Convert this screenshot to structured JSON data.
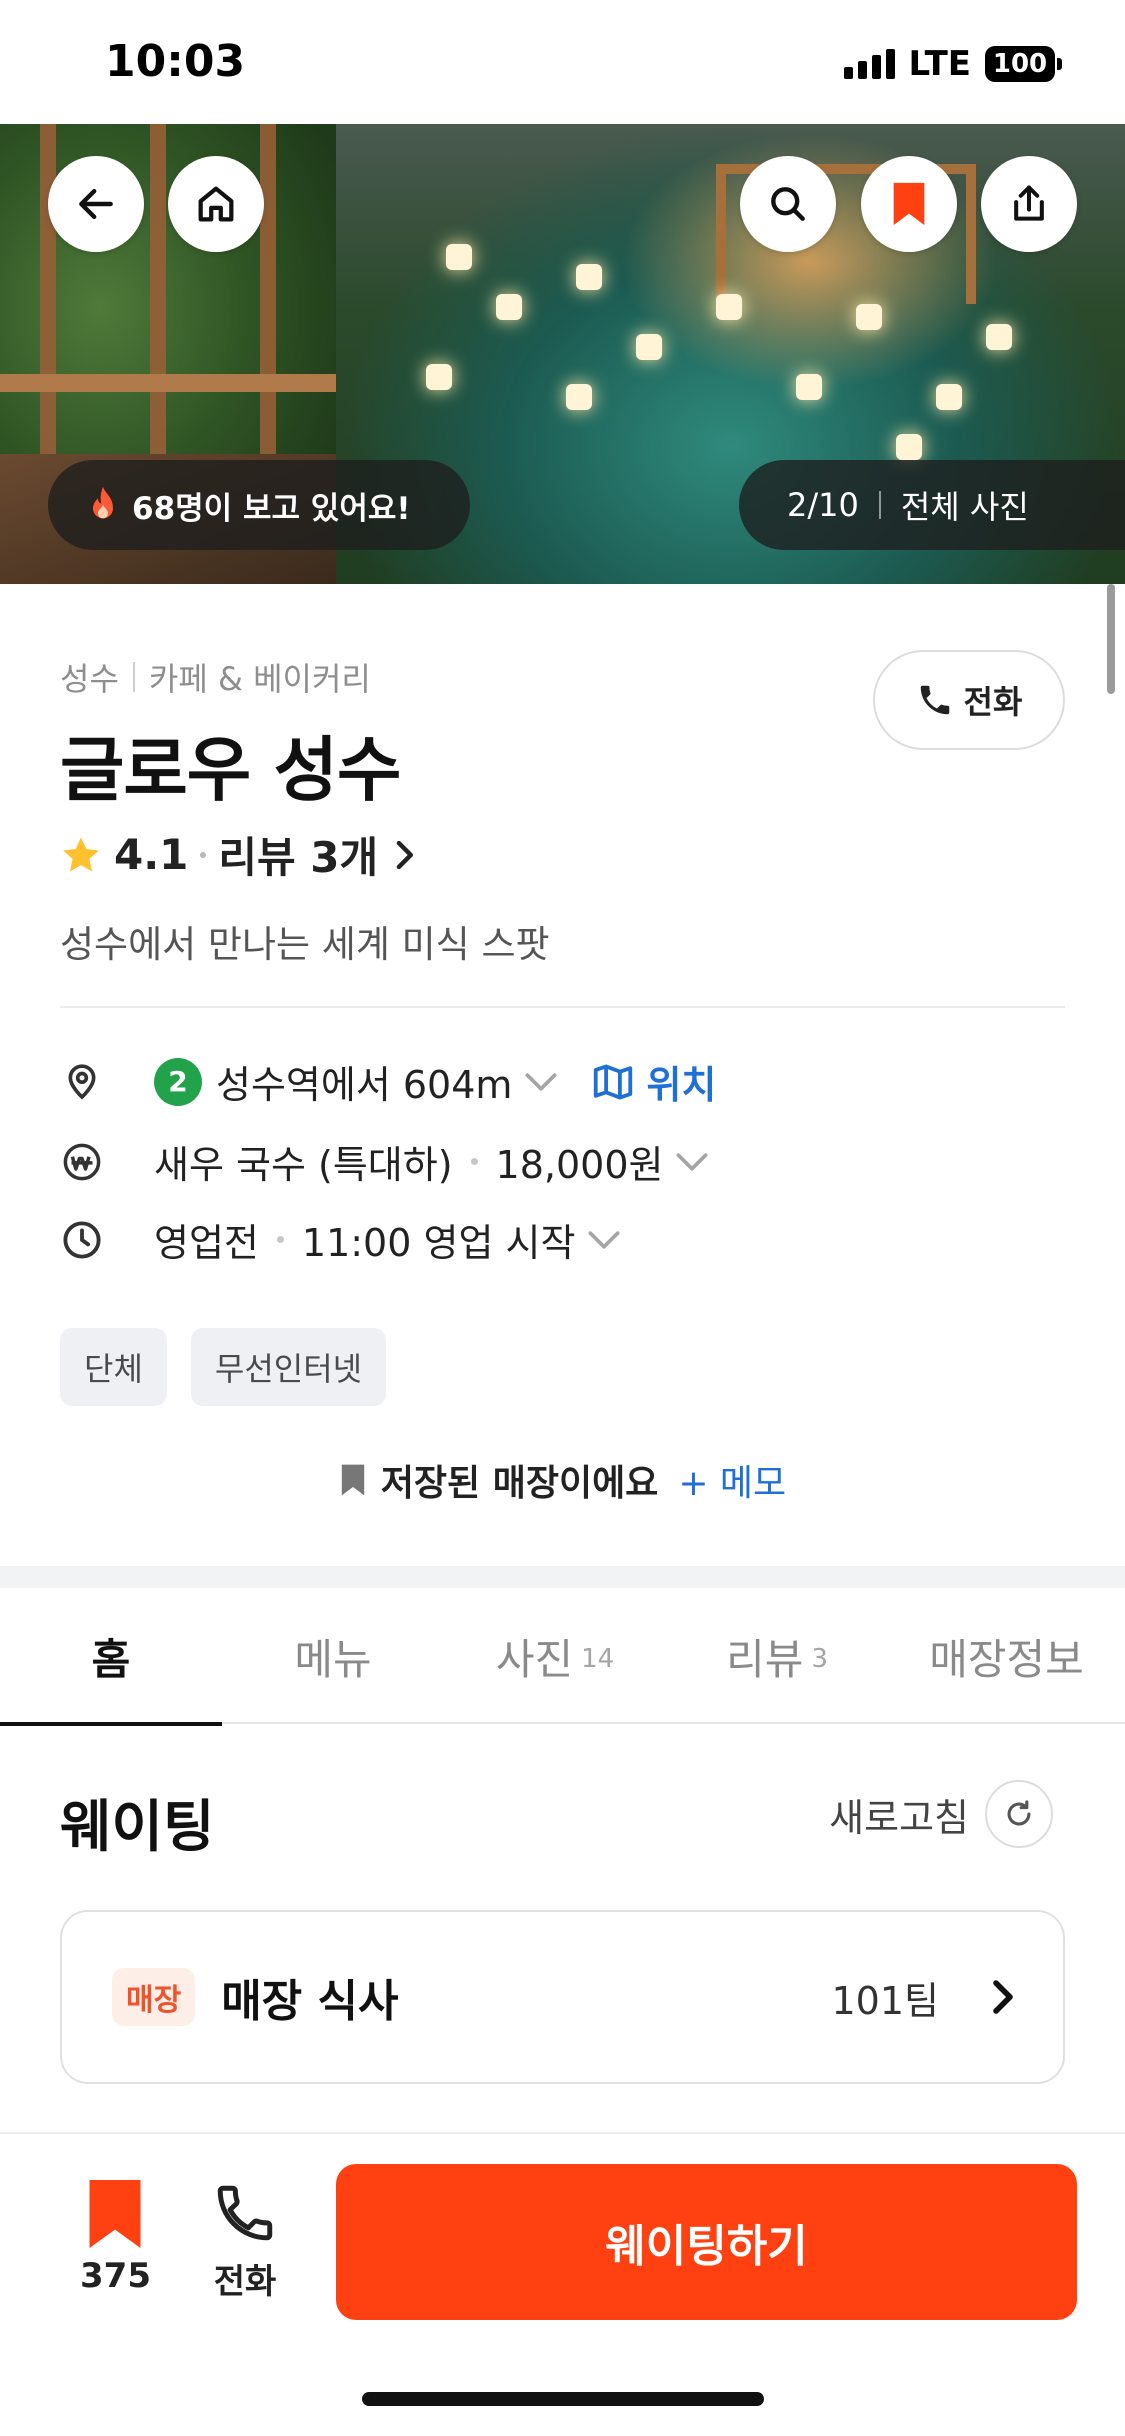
{
  "status_bar": {
    "time": "10:03",
    "network": "LTE",
    "battery": "100"
  },
  "hero": {
    "viewers_text": "68명이 보고 있어요!",
    "photo_index": "2/10",
    "all_photos_label": "전체 사진"
  },
  "store": {
    "area": "성수",
    "category": "카페 & 베이커리",
    "name": "글로우 성수",
    "rating": "4.1",
    "review_link": "리뷰 3개",
    "description": "성수에서 만나는 세계 미식 스팟",
    "call_label": "전화"
  },
  "details": {
    "subway_line": "2",
    "distance": "성수역에서 604m",
    "map_label": "위치",
    "menu_item": "새우 국수 (특대하)",
    "menu_price": "18,000원",
    "open_status": "영업전",
    "open_time": "11:00 영업 시작"
  },
  "tags": [
    "단체",
    "무선인터넷"
  ],
  "saved": {
    "text": "저장된 매장이에요",
    "memo": "+ 메모"
  },
  "tabs": [
    {
      "label": "홈",
      "count": ""
    },
    {
      "label": "메뉴",
      "count": ""
    },
    {
      "label": "사진",
      "count": "14"
    },
    {
      "label": "리뷰",
      "count": "3"
    },
    {
      "label": "매장정보",
      "count": ""
    }
  ],
  "waiting": {
    "title": "웨이팅",
    "refresh_label": "새로고침",
    "badge": "매장",
    "type": "매장 식사",
    "teams": "101팀"
  },
  "bottom_bar": {
    "bookmark_count": "375",
    "call_label": "전화",
    "cta_label": "웨이팅하기"
  },
  "colors": {
    "accent": "#ff4112",
    "link": "#1f6fd6",
    "line2": "#22a34b"
  }
}
